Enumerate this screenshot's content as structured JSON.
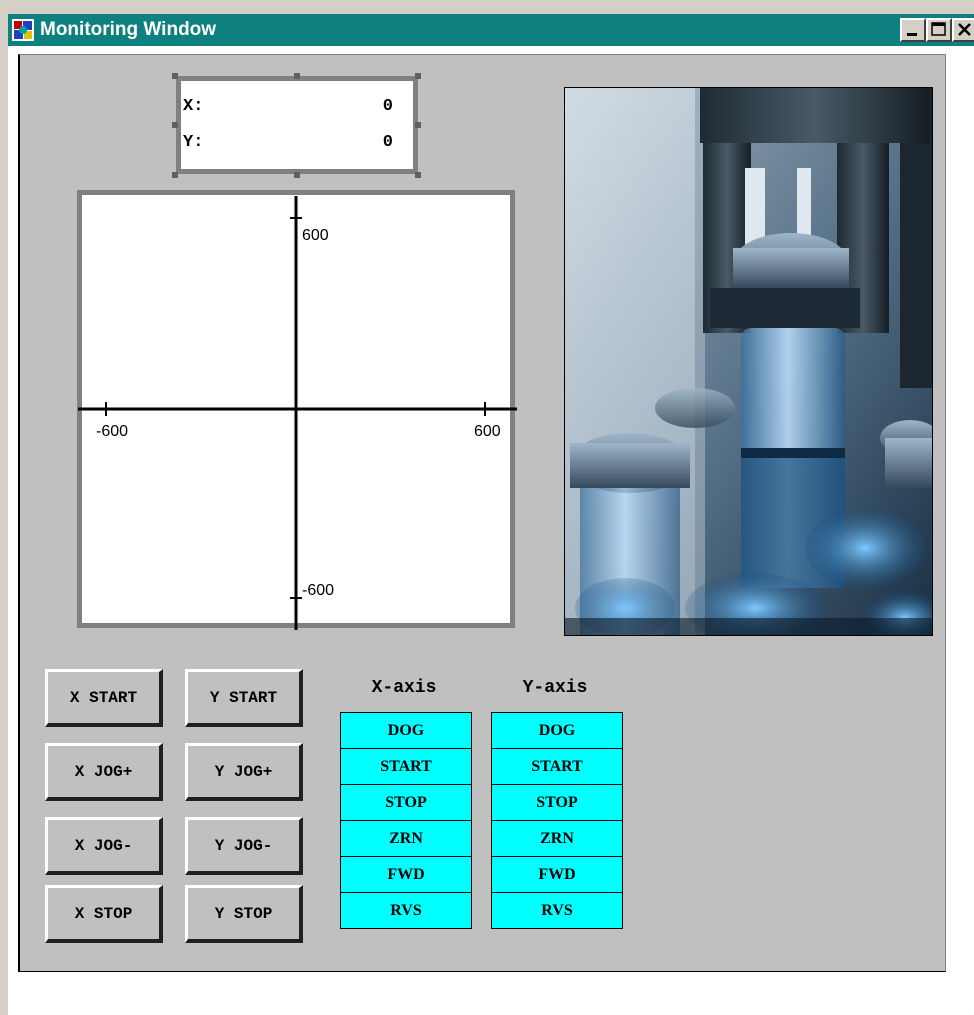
{
  "window": {
    "title": "Monitoring Window",
    "titlebar_color": "#0e8080",
    "panel_color": "#c0c0c0",
    "buttons": [
      "minimize-icon",
      "maximize-icon",
      "close-icon"
    ]
  },
  "position": {
    "x_label": "X:",
    "x_value": "0",
    "y_label": "Y:",
    "y_value": "0"
  },
  "plot": {
    "y_max_label": "600",
    "y_min_label": "-600",
    "x_min_label": "-600",
    "x_max_label": "600",
    "range": [
      -600,
      600
    ],
    "marker": [
      0,
      0
    ]
  },
  "controls": {
    "x_start": "X START",
    "x_jog_plus": "X JOG+",
    "x_jog_minus": "X JOG-",
    "x_stop": "X STOP",
    "y_start": "Y START",
    "y_jog_plus": "Y JOG+",
    "y_jog_minus": "Y JOG-",
    "y_stop": "Y STOP"
  },
  "signals": {
    "indicator_color": "#00ffff",
    "x_axis": {
      "heading": "X-axis",
      "items": [
        "DOG",
        "START",
        "STOP",
        "ZRN",
        "FWD",
        "RVS"
      ]
    },
    "y_axis": {
      "heading": "Y-axis",
      "items": [
        "DOG",
        "START",
        "STOP",
        "ZRN",
        "FWD",
        "RVS"
      ]
    }
  }
}
